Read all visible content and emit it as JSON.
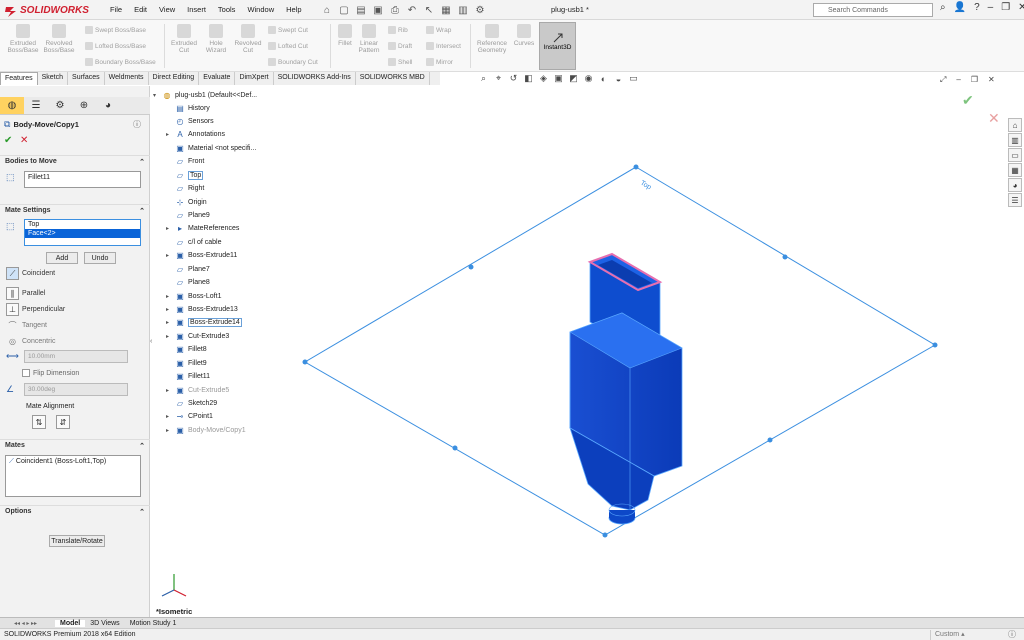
{
  "app": {
    "logo_text": "SOLIDWORKS",
    "doc_title": "plug-usb1 *"
  },
  "menu": [
    "File",
    "Edit",
    "View",
    "Insert",
    "Tools",
    "Window",
    "Help"
  ],
  "search": {
    "placeholder": "Search Commands"
  },
  "ribbon": {
    "extruded_boss": "Extruded Boss/Base",
    "revolved_boss": "Revolved Boss/Base",
    "swept_boss": "Swept Boss/Base",
    "lofted_boss": "Lofted Boss/Base",
    "boundary_boss": "Boundary Boss/Base",
    "extruded_cut": "Extruded Cut",
    "hole_wizard": "Hole Wizard",
    "revolved_cut": "Revolved Cut",
    "swept_cut": "Swept Cut",
    "lofted_cut": "Lofted Cut",
    "boundary_cut": "Boundary Cut",
    "fillet": "Fillet",
    "linear_pattern": "Linear Pattern",
    "rib": "Rib",
    "wrap": "Wrap",
    "draft": "Draft",
    "intersect": "Intersect",
    "shell": "Shell",
    "mirror": "Mirror",
    "reference_geometry": "Reference Geometry",
    "curves": "Curves",
    "instant3d": "Instant3D"
  },
  "tabs": [
    "Features",
    "Sketch",
    "Surfaces",
    "Weldments",
    "Direct Editing",
    "Evaluate",
    "DimXpert",
    "SOLIDWORKS Add-Ins",
    "SOLIDWORKS MBD"
  ],
  "property_manager": {
    "title": "Body-Move/Copy1",
    "bodies_to_move": "Bodies to Move",
    "bodies_value": "Fillet11",
    "mate_settings": "Mate Settings",
    "mate_items": [
      "Top",
      "Face<2>"
    ],
    "add": "Add",
    "undo": "Undo",
    "coincident": "Coincident",
    "parallel": "Parallel",
    "perpendicular": "Perpendicular",
    "tangent": "Tangent",
    "concentric": "Concentric",
    "distance_value": "10.00mm",
    "flip_dimension": "Flip Dimension",
    "angle_value": "30.00deg",
    "mate_alignment": "Mate Alignment",
    "mates": "Mates",
    "mates_value": "Coincident1 (Boss-Loft1,Top)",
    "options": "Options",
    "translate_rotate": "Translate/Rotate"
  },
  "tree": {
    "root": "plug-usb1  (Default<<Def...",
    "items": [
      "History",
      "Sensors",
      "Annotations",
      "Material <not specifi...",
      "Front",
      "Top",
      "Right",
      "Origin",
      "Plane9",
      "MateReferences",
      "c/l of cable",
      "Boss-Extrude11",
      "Plane7",
      "Plane8",
      "Boss-Loft1",
      "Boss-Extrude13",
      "Boss-Extrude14",
      "Cut-Extrude3",
      "Fillet8",
      "Fillet9",
      "Fillet11",
      "Cut-Extrude5",
      "Sketch29",
      "CPoint1",
      "Body-Move/Copy1"
    ]
  },
  "viewport": {
    "plane_label": "Top",
    "view_name": "*Isometric"
  },
  "bottom_tabs": [
    "Model",
    "3D Views",
    "Motion Study 1"
  ],
  "status": {
    "edition": "SOLIDWORKS Premium 2018 x64 Edition",
    "units": "Custom"
  },
  "colors": {
    "plane": "#3b8fe0",
    "model": "#0d57d6",
    "highlight": "#e66fb0",
    "accent": "#d01f2f"
  }
}
